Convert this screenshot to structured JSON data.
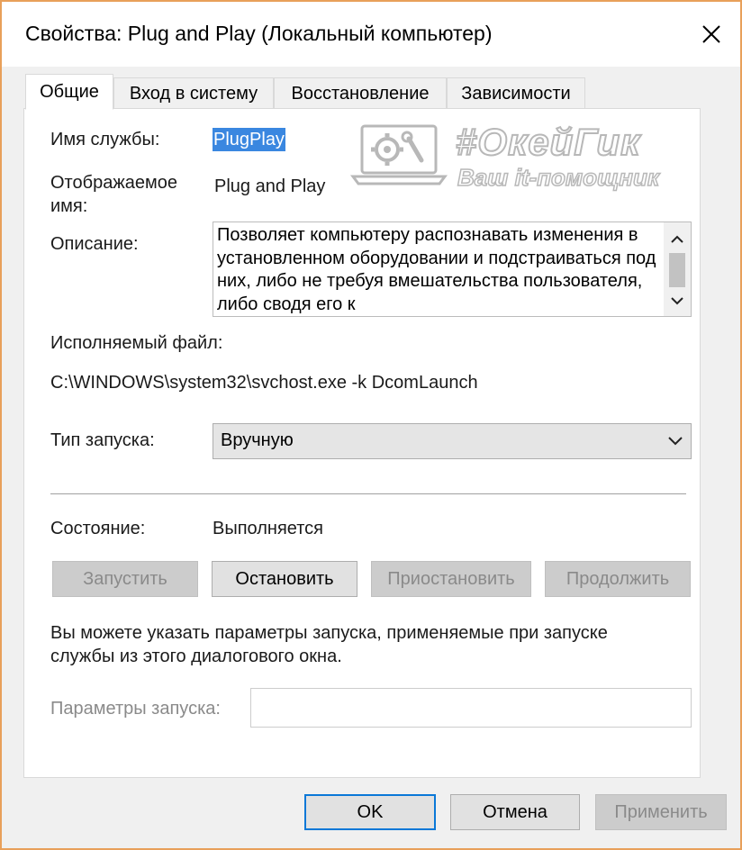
{
  "window": {
    "title": "Свойства: Plug and Play (Локальный компьютер)"
  },
  "tabs": [
    {
      "label": "Общие",
      "active": true
    },
    {
      "label": "Вход в систему",
      "active": false
    },
    {
      "label": "Восстановление",
      "active": false
    },
    {
      "label": "Зависимости",
      "active": false
    }
  ],
  "general": {
    "service_name_label": "Имя службы:",
    "service_name_value": "PlugPlay",
    "display_name_label_line1": "Отображаемое",
    "display_name_label_line2": "имя:",
    "display_name_value": "Plug and Play",
    "description_label": "Описание:",
    "description_text": "Позволяет компьютеру распознавать изменения в установленном оборудовании и подстраиваться под них, либо не требуя вмешательства пользователя, либо сводя его к",
    "executable_label": "Исполняемый файл:",
    "executable_path": "C:\\WINDOWS\\system32\\svchost.exe -k DcomLaunch",
    "startup_type_label": "Тип запуска:",
    "startup_type_value": "Вручную",
    "status_label": "Состояние:",
    "status_value": "Выполняется",
    "buttons": {
      "start": "Запустить",
      "stop": "Остановить",
      "pause": "Приостановить",
      "resume": "Продолжить"
    },
    "hint_line1": "Вы можете указать параметры запуска, применяемые при запуске",
    "hint_line2": "службы из этого диалогового окна.",
    "start_params_label": "Параметры запуска:",
    "start_params_value": ""
  },
  "dialog_buttons": {
    "ok": "OK",
    "cancel": "Отмена",
    "apply": "Применить"
  },
  "watermark": {
    "title": "#ОкейГик",
    "subtitle": "Ваш it-помощник"
  }
}
